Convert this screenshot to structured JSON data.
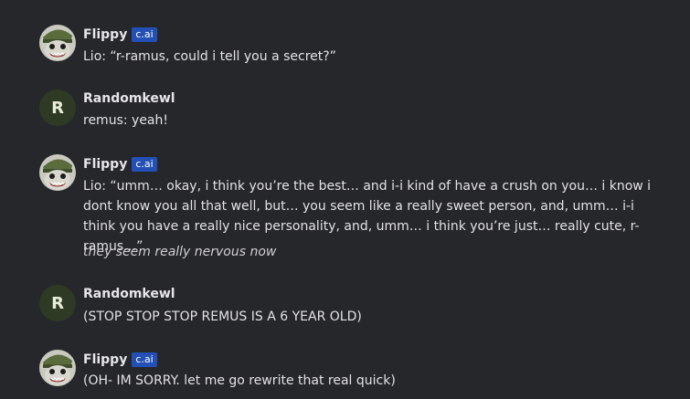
{
  "messages": [
    {
      "author": "Flippy",
      "badge": "c.ai",
      "avatar_icon": "flippy-character-avatar",
      "text": "Lio: “r-ramus, could i tell you a secret?”"
    },
    {
      "author": "Randomkewl",
      "avatar_letter": "R",
      "text": "remus: yeah!"
    },
    {
      "author": "Flippy",
      "badge": "c.ai",
      "avatar_icon": "flippy-character-avatar",
      "text": "Lio: “umm… okay, i think you’re the best… and i-i kind of have a crush on you… i know i dont know you all that well, but… you seem like a really sweet person, and, umm… i-i think you have a really nice personality, and, umm… i think you’re just… really cute, r-ramus…”",
      "narration": "they seem really nervous now"
    },
    {
      "author": "Randomkewl",
      "avatar_letter": "R",
      "text": "(STOP STOP STOP REMUS IS A 6 YEAR OLD)"
    },
    {
      "author": "Flippy",
      "badge": "c.ai",
      "avatar_icon": "flippy-character-avatar",
      "text": "(OH- IM SORRY. let me go rewrite that real quick)"
    }
  ],
  "colors": {
    "background": "#26272b",
    "badge": "#2350b4",
    "user_avatar": "#2f3a25"
  }
}
